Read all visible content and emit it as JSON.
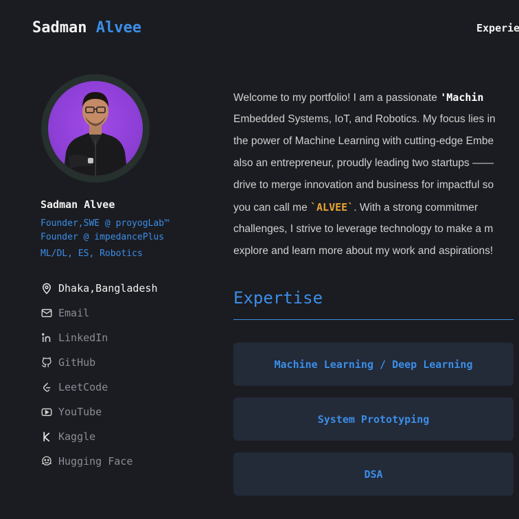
{
  "header": {
    "brand_first": "Sadman",
    "brand_last": "Alvee",
    "nav_item": "Experie"
  },
  "profile": {
    "name": "Sadman Alvee",
    "roles": [
      "Founder,SWE @ proyogLab™",
      "Founder @ impedancePlus",
      "ML/DL, ES, Robotics"
    ],
    "location": "Dhaka,Bangladesh",
    "links": [
      {
        "label": "Email",
        "icon": "mail-icon"
      },
      {
        "label": "LinkedIn",
        "icon": "linkedin-icon"
      },
      {
        "label": "GitHub",
        "icon": "github-icon"
      },
      {
        "label": "LeetCode",
        "icon": "leetcode-icon"
      },
      {
        "label": "YouTube",
        "icon": "youtube-icon"
      },
      {
        "label": "Kaggle",
        "icon": "kaggle-icon"
      },
      {
        "label": "Hugging Face",
        "icon": "hugging-face-icon"
      }
    ]
  },
  "intro": {
    "l1_a": "Welcome to my portfolio! I am a passionate ",
    "l1_b": "'Machin",
    "l2": "Embedded Systems, IoT, and Robotics. My focus lies in",
    "l3": "the power of Machine Learning with cutting-edge Embe",
    "l4": "also an entrepreneur, proudly leading two startups ——",
    "l5": "drive to merge innovation and business for impactful so",
    "l6_a": "you can call me ",
    "l6_b": "`ALVEE`",
    "l6_c": ". With a strong commitmer",
    "l7": "challenges, I strive to leverage technology to make a m",
    "l8": "explore and learn more about my work and aspirations!"
  },
  "expertise": {
    "title": "Expertise",
    "items": [
      "Machine Learning / Deep Learning",
      "System Prototyping",
      "DSA"
    ]
  },
  "colors": {
    "background": "#1b1c21",
    "accent": "#3b8ee8",
    "highlight": "#e6a534",
    "card": "#232a38"
  }
}
